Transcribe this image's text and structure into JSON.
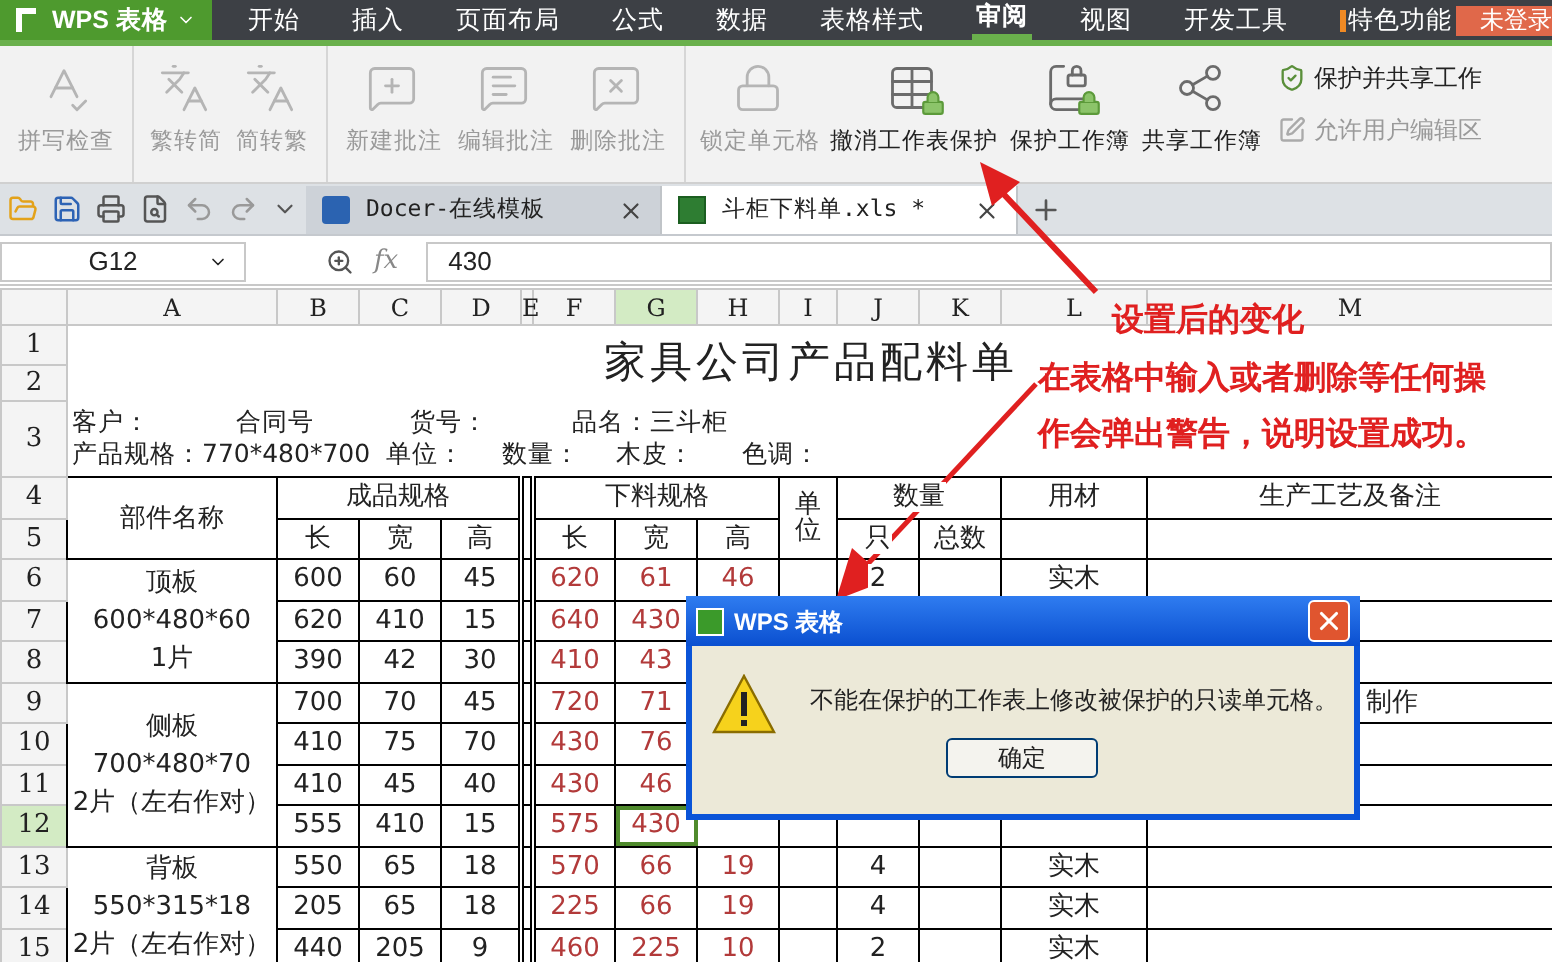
{
  "app_menu": {
    "title": "WPS 表格"
  },
  "menu": [
    {
      "label": "开始",
      "selected": false
    },
    {
      "label": "插入",
      "selected": false
    },
    {
      "label": "页面布局",
      "selected": false
    },
    {
      "label": "公式",
      "selected": false
    },
    {
      "label": "数据",
      "selected": false
    },
    {
      "label": "表格样式",
      "selected": false
    },
    {
      "label": "审阅",
      "selected": true
    },
    {
      "label": "视图",
      "selected": false
    },
    {
      "label": "开发工具",
      "selected": false
    },
    {
      "label": "特色功能",
      "selected": false
    }
  ],
  "login_button": "未登录",
  "ribbon_groups": [
    {
      "items": [
        {
          "kind": "large",
          "label": "拼写检查",
          "disabled": true
        }
      ]
    },
    {
      "items": [
        {
          "kind": "large",
          "label": "繁转简",
          "disabled": true
        },
        {
          "kind": "large",
          "label": "简转繁",
          "disabled": true
        }
      ]
    },
    {
      "items": [
        {
          "kind": "large",
          "label": "新建批注",
          "disabled": true
        },
        {
          "kind": "large",
          "label": "编辑批注",
          "disabled": true
        },
        {
          "kind": "large",
          "label": "删除批注",
          "disabled": true
        }
      ]
    },
    {
      "items": [
        {
          "kind": "large",
          "label": "锁定单元格",
          "disabled": true
        },
        {
          "kind": "large",
          "label": "撤消工作表保护",
          "disabled": false
        },
        {
          "kind": "large",
          "label": "保护工作簿",
          "disabled": false
        },
        {
          "kind": "large",
          "label": "共享工作簿",
          "disabled": false
        },
        {
          "kind": "small",
          "label": "保护并共享工作",
          "disabled": false
        },
        {
          "kind": "small",
          "label": "允许用户编辑区",
          "disabled": true
        }
      ]
    }
  ],
  "doc_tabs": [
    {
      "label": "Docer-在线模板",
      "selected": false
    },
    {
      "label": "斗柜下料单.xls *",
      "selected": true
    }
  ],
  "formula_bar": {
    "cell": "G12",
    "fx_label": "fx",
    "value": "430"
  },
  "columns": [
    {
      "label": "A",
      "selected": false
    },
    {
      "label": "B",
      "selected": false
    },
    {
      "label": "C",
      "selected": false
    },
    {
      "label": "D",
      "selected": false
    },
    {
      "label": "E",
      "selected": false
    },
    {
      "label": "F",
      "selected": false
    },
    {
      "label": "G",
      "selected": true
    },
    {
      "label": "H",
      "selected": false
    },
    {
      "label": "I",
      "selected": false
    },
    {
      "label": "J",
      "selected": false
    },
    {
      "label": "K",
      "selected": false
    },
    {
      "label": "L",
      "selected": false
    },
    {
      "label": "M",
      "selected": false
    }
  ],
  "row_numbers": [
    {
      "label": "1",
      "selected": false
    },
    {
      "label": "2",
      "selected": false
    },
    {
      "label": "3",
      "selected": false
    },
    {
      "label": "4",
      "selected": false
    },
    {
      "label": "5",
      "selected": false
    },
    {
      "label": "6",
      "selected": false
    },
    {
      "label": "7",
      "selected": false
    },
    {
      "label": "8",
      "selected": false
    },
    {
      "label": "9",
      "selected": false
    },
    {
      "label": "10",
      "selected": false
    },
    {
      "label": "11",
      "selected": false
    },
    {
      "label": "12",
      "selected": true
    },
    {
      "label": "13",
      "selected": false
    },
    {
      "label": "14",
      "selected": false
    },
    {
      "label": "15",
      "selected": false
    }
  ],
  "sheet": {
    "title": "家具公司产品配料单",
    "info_lines": [
      [
        "客户：",
        "合同号",
        "货号：",
        "品名：三斗柜"
      ],
      [
        "产品规格：770*480*700",
        "单位：",
        "数量：",
        "木皮：",
        "色调："
      ]
    ],
    "headers": {
      "part": "部件名称",
      "finished": "成品规格",
      "cut": "下料规格",
      "unit": "单位",
      "quantity": "数量",
      "material": "用材",
      "notes": "生产工艺及备注",
      "finished_sub": [
        "长",
        "宽",
        "高"
      ],
      "cut_sub": [
        "长",
        "宽",
        "高"
      ],
      "quantity_sub": [
        "只",
        "总数"
      ]
    },
    "parts": [
      {
        "lines": [
          "顶板",
          "600*480*60",
          "1片"
        ],
        "rows": [
          {
            "B": "600",
            "C": "60",
            "D": "45",
            "F": "620",
            "G": "61",
            "H": "46",
            "J": "2",
            "L": "实木"
          },
          {
            "B": "620",
            "C": "410",
            "D": "15",
            "F": "640",
            "G": "430"
          },
          {
            "B": "390",
            "C": "42",
            "D": "30",
            "F": "410",
            "G": "43"
          }
        ]
      },
      {
        "lines": [
          "侧板",
          "700*480*70",
          "2片（左右作对）"
        ],
        "rows": [
          {
            "B": "700",
            "C": "70",
            "D": "45",
            "F": "720",
            "G": "71",
            "M": "制作"
          },
          {
            "B": "410",
            "C": "75",
            "D": "70",
            "F": "430",
            "G": "76"
          },
          {
            "B": "410",
            "C": "45",
            "D": "40",
            "F": "430",
            "G": "46"
          },
          {
            "B": "555",
            "C": "410",
            "D": "15",
            "F": "575",
            "G": "430"
          }
        ]
      },
      {
        "lines": [
          "背板",
          "550*315*18",
          "2片（左右作对）"
        ],
        "rows": [
          {
            "B": "550",
            "C": "65",
            "D": "18",
            "F": "570",
            "G": "66",
            "H": "19",
            "J": "4",
            "L": "实木"
          },
          {
            "B": "205",
            "C": "65",
            "D": "18",
            "F": "225",
            "G": "66",
            "H": "19",
            "J": "4",
            "L": "实木"
          },
          {
            "B": "440",
            "C": "205",
            "D": "9",
            "F": "460",
            "G": "225",
            "H": "10",
            "J": "2",
            "L": "实木"
          }
        ]
      }
    ]
  },
  "dialog": {
    "title": "WPS 表格",
    "message": "不能在保护的工作表上修改被保护的只读单元格。",
    "button": "确定"
  },
  "annotations": [
    {
      "lines": [
        "设置后的变化"
      ]
    },
    {
      "lines": [
        "在表格中输入或者删除等任何操",
        "作会弹出警告，说明设置成功。"
      ]
    }
  ]
}
